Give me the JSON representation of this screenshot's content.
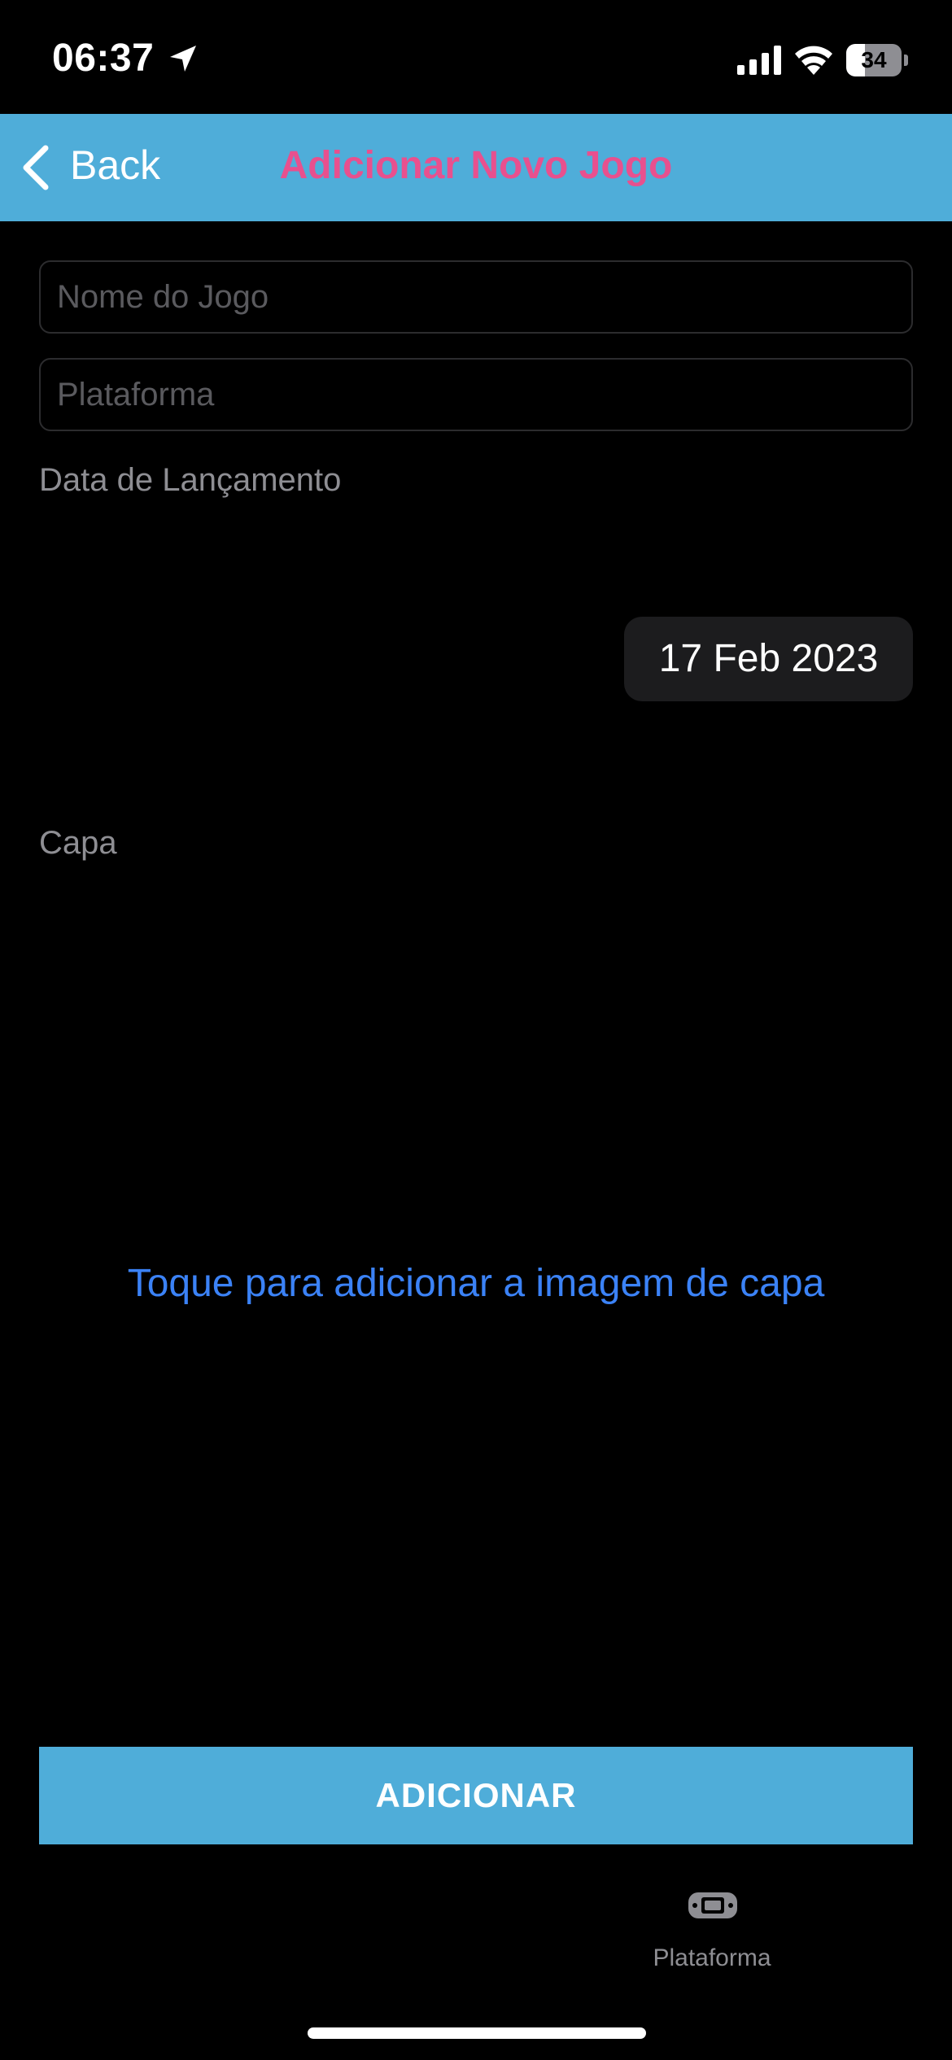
{
  "status_bar": {
    "time": "06:37",
    "battery_level": "34",
    "battery_fraction": 0.34
  },
  "nav": {
    "back_label": "Back",
    "title": "Adicionar Novo Jogo"
  },
  "form": {
    "name_placeholder": "Nome do Jogo",
    "name_value": "",
    "platform_placeholder": "Plataforma",
    "platform_value": "",
    "release_date_label": "Data de Lançamento",
    "release_date_value": "17 Feb 2023",
    "cover_label": "Capa",
    "cover_hint": "Toque para adicionar a imagem de capa",
    "submit_label": "ADICIONAR"
  },
  "tab_bar": {
    "items": [
      {
        "label": "Plataforma",
        "icon": "gamepad-icon"
      }
    ]
  },
  "colors": {
    "nav_background": "#4fadd9",
    "title_color": "#e8508e",
    "link_color": "#3b82f6",
    "button_background": "#4fadd9"
  }
}
